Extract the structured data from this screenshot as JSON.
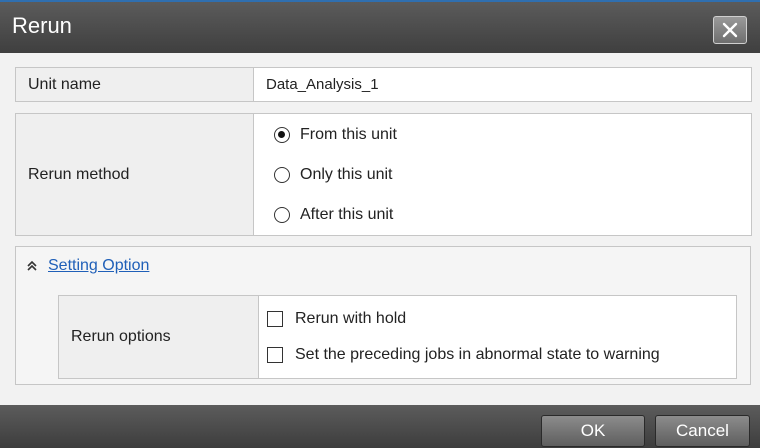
{
  "dialog": {
    "title": "Rerun",
    "close_icon": "close-icon"
  },
  "unit": {
    "label": "Unit name",
    "value": "Data_Analysis_1"
  },
  "rerun_method": {
    "label": "Rerun method",
    "options": [
      {
        "label": "From this unit",
        "selected": true
      },
      {
        "label": "Only this unit",
        "selected": false
      },
      {
        "label": "After this unit",
        "selected": false
      }
    ]
  },
  "setting_option": {
    "link_label": "Setting Option",
    "icon": "double-chevron-up-icon",
    "rerun_options_label": "Rerun options",
    "checkboxes": [
      {
        "label": "Rerun with hold",
        "checked": false
      },
      {
        "label": "Set the preceding jobs in abnormal state to warning",
        "checked": false
      }
    ]
  },
  "buttons": {
    "ok": "OK",
    "cancel": "Cancel"
  },
  "colors": {
    "title_bar": "#4b4b4b",
    "accent_border": "#2f6fb0",
    "link": "#1f5fb8"
  }
}
